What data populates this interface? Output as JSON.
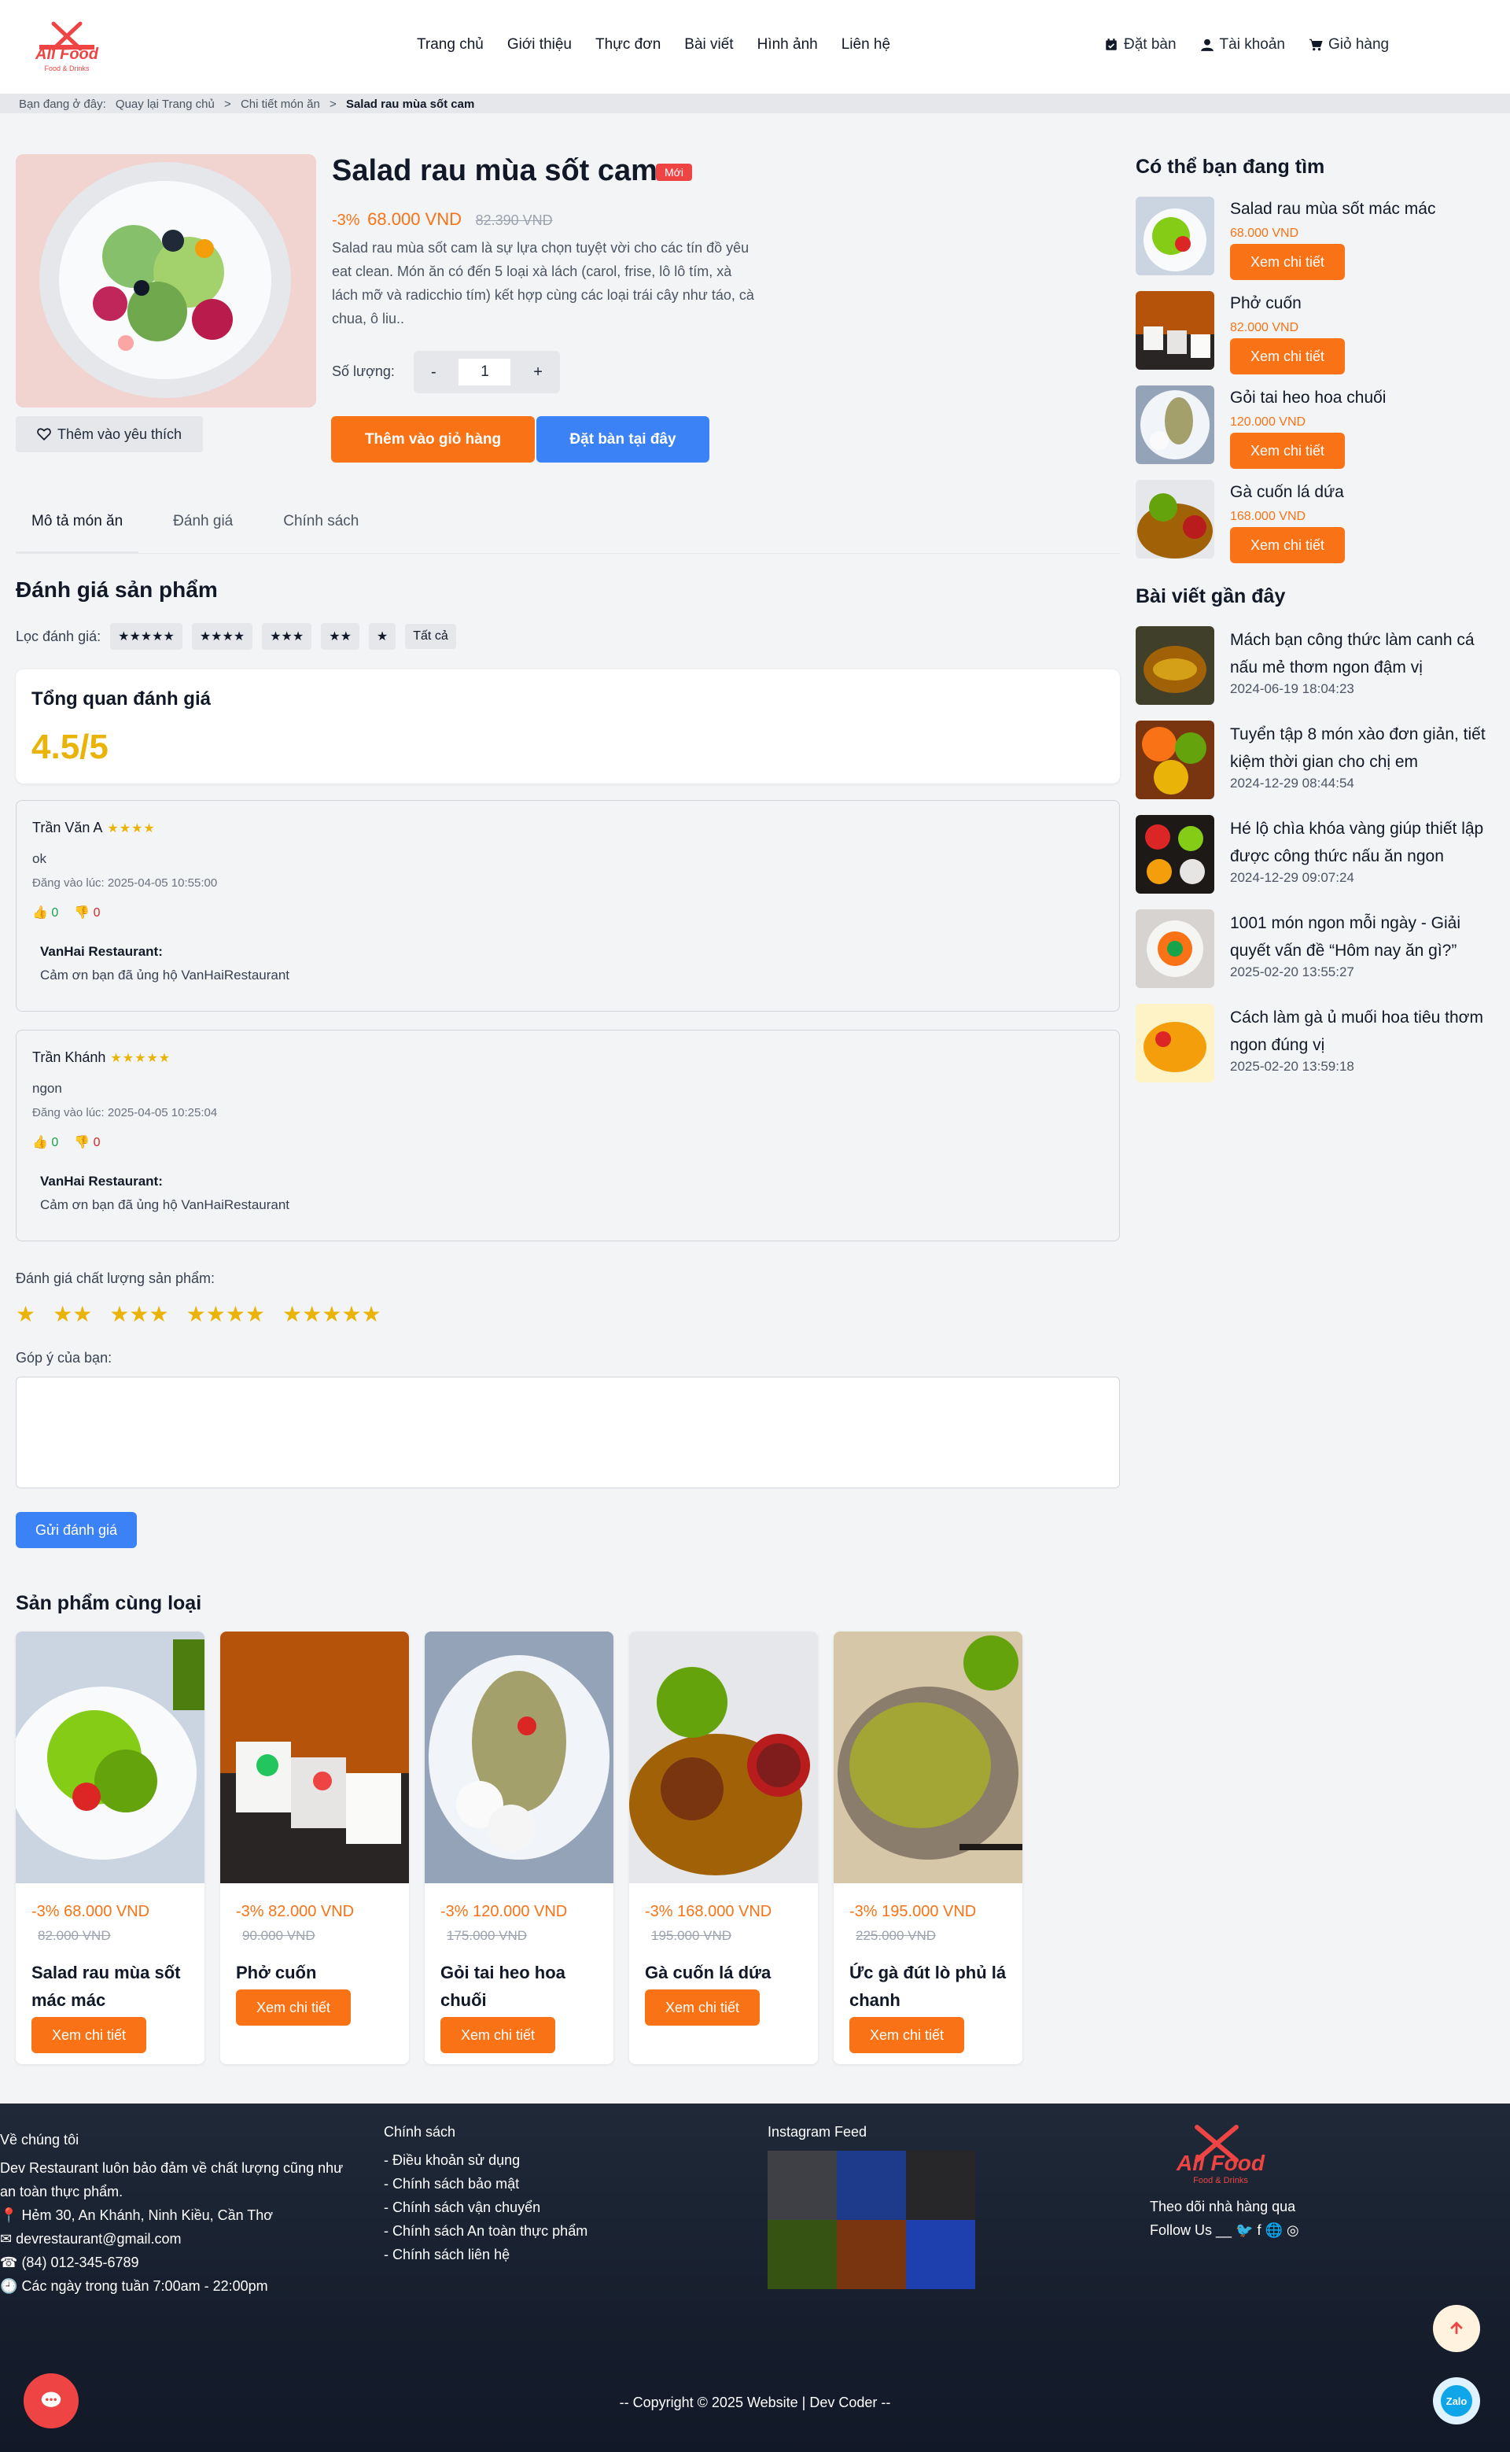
{
  "brand": {
    "name": "All Food",
    "tagline": "Food & Drinks"
  },
  "nav": [
    "Trang chủ",
    "Giới thiệu",
    "Thực đơn",
    "Bài viết",
    "Hình ảnh",
    "Liên hệ"
  ],
  "actions": {
    "book": "Đặt bàn",
    "account": "Tài khoản",
    "cart": "Giỏ hàng"
  },
  "breadcrumb": {
    "prefix": "Bạn đang ở đây:",
    "items": [
      "Quay lại Trang chủ",
      "Chi tiết món ăn",
      "Salad rau mùa sốt cam"
    ],
    "sep": ">"
  },
  "product": {
    "title": "Salad rau mùa sốt cam",
    "badge": "Mới",
    "discount": "-3%",
    "price": "68.000 VND",
    "old_price": "82.390 VND",
    "description": "Salad rau mùa sốt cam là sự lựa chọn tuyệt vời cho các tín đồ yêu eat clean. Món ăn có đến 5 loại xà lách (carol, frise, lô lô tím, xà lách mỡ và radicchio tím) kết hợp cùng các loại trái cây như táo, cà chua, ô liu..",
    "qty_label": "Số lượng:",
    "qty_minus": "-",
    "qty_value": "1",
    "qty_plus": "+",
    "wishlist": "Thêm vào yêu thích",
    "add_cart": "Thêm vào giỏ hàng",
    "book_now": "Đặt bàn tại đây"
  },
  "tabs": [
    "Mô tả món ăn",
    "Đánh giá",
    "Chính sách"
  ],
  "reviews": {
    "title": "Đánh giá sản phẩm",
    "filter_label": "Lọc đánh giá:",
    "filters": [
      "★★★★★",
      "★★★★",
      "★★★",
      "★★",
      "★",
      "Tất cả"
    ],
    "overview_title": "Tổng quan đánh giá",
    "score": "4.5/5",
    "items": [
      {
        "name": "Trần Văn A",
        "stars": "★★★★",
        "content": "ok",
        "date": "Đăng vào lúc: 2025-04-05 10:55:00",
        "likes": "0",
        "dislikes": "0",
        "reply_name": "VanHai Restaurant:",
        "reply": "Cảm ơn bạn đã ủng hộ VanHaiRestaurant"
      },
      {
        "name": "Trần Khánh",
        "stars": "★★★★★",
        "content": "ngon",
        "date": "Đăng vào lúc: 2025-04-05 10:25:04",
        "likes": "0",
        "dislikes": "0",
        "reply_name": "VanHai Restaurant:",
        "reply": "Cảm ơn bạn đã ủng hộ VanHaiRestaurant"
      }
    ],
    "rate_label": "Đánh giá chất lượng sản phẩm:",
    "rate_options": [
      "★",
      "★★",
      "★★★",
      "★★★★",
      "★★★★★"
    ],
    "feedback_label": "Góp ý của bạn:",
    "submit": "Gửi đánh giá"
  },
  "related": {
    "title": "Sản phẩm cùng loại",
    "items": [
      {
        "discount": "-3%",
        "price": "68.000 VND",
        "old": "82.000 VND",
        "name": "Salad rau mùa sốt mác mác",
        "btn": "Xem chi tiết"
      },
      {
        "discount": "-3%",
        "price": "82.000 VND",
        "old": "90.000 VND",
        "name": "Phở cuốn",
        "btn": "Xem chi tiết"
      },
      {
        "discount": "-3%",
        "price": "120.000 VND",
        "old": "175.000 VND",
        "name": "Gỏi tai heo hoa chuối",
        "btn": "Xem chi tiết"
      },
      {
        "discount": "-3%",
        "price": "168.000 VND",
        "old": "195.000 VND",
        "name": "Gà cuốn lá dứa",
        "btn": "Xem chi tiết"
      },
      {
        "discount": "-3%",
        "price": "195.000 VND",
        "old": "225.000 VND",
        "name": "Ức gà đút lò phủ lá chanh",
        "btn": "Xem chi tiết"
      }
    ]
  },
  "sidebar": {
    "search_title": "Có thể bạn đang tìm",
    "products": [
      {
        "name": "Salad rau mùa sốt mác mác",
        "price": "68.000 VND",
        "btn": "Xem chi tiết"
      },
      {
        "name": "Phở cuốn",
        "price": "82.000 VND",
        "btn": "Xem chi tiết"
      },
      {
        "name": "Gỏi tai heo hoa chuối",
        "price": "120.000 VND",
        "btn": "Xem chi tiết"
      },
      {
        "name": "Gà cuốn lá dứa",
        "price": "168.000 VND",
        "btn": "Xem chi tiết"
      }
    ],
    "posts_title": "Bài viết gần đây",
    "posts": [
      {
        "title": "Mách bạn công thức làm canh cá nấu mẻ thơm ngon đậm vị",
        "date": "2024-06-19 18:04:23"
      },
      {
        "title": "Tuyển tập 8 món xào đơn giản, tiết kiệm thời gian cho chị em",
        "date": "2024-12-29 08:44:54"
      },
      {
        "title": "Hé lộ chìa khóa vàng giúp thiết lập được công thức nấu ăn ngon",
        "date": "2024-12-29 09:07:24"
      },
      {
        "title": "1001 món ngon mỗi ngày - Giải quyết vấn đề “Hôm nay ăn gì?”",
        "date": "2025-02-20 13:55:27"
      },
      {
        "title": "Cách làm gà ủ muối hoa tiêu thơm ngon đúng vị",
        "date": "2025-02-20 13:59:18"
      }
    ]
  },
  "footer": {
    "about_title": "Về chúng tôi",
    "about_text": "Dev Restaurant luôn bảo đảm về chất lượng cũng như an toàn thực phẩm.",
    "address": "Hẻm 30, An Khánh, Ninh Kiều, Cần Thơ",
    "email": "devrestaurant@gmail.com",
    "phone": "(84) 012-345-6789",
    "hours": "Các ngày trong tuần 7:00am - 22:00pm",
    "policy_title": "Chính sách",
    "policies": [
      "- Điều khoản sử dụng",
      "- Chính sách bảo mật",
      "- Chính sách vận chuyển",
      "- Chính sách An toàn thực phẩm",
      "- Chính sách liên hệ"
    ],
    "insta_title": "Instagram Feed",
    "follow_text": "Theo dõi nhà hàng qua",
    "follow_us": "Follow Us __",
    "copyright": "-- Copyright © 2025 Website | Dev Coder --",
    "zalo": "Zalo"
  },
  "colors": {
    "accent": "#f97316",
    "primary": "#3b82f6",
    "star": "#eab308",
    "badge": "#ef4444"
  }
}
